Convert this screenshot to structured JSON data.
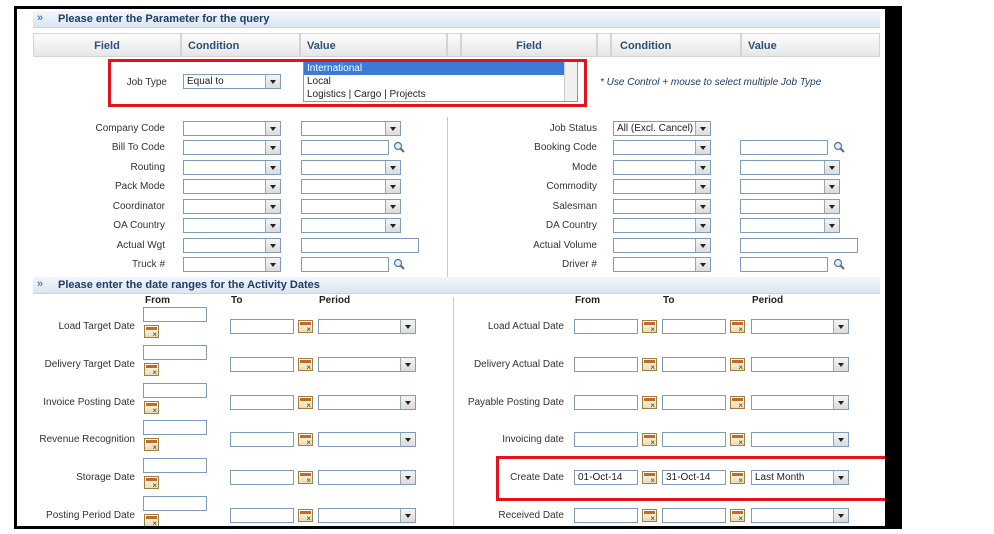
{
  "param_section": {
    "title": "Please enter the Parameter for the query"
  },
  "date_section": {
    "title": "Please enter the date ranges for the Activity Dates"
  },
  "columns": {
    "field": "Field",
    "condition": "Condition",
    "value": "Value"
  },
  "job_type": {
    "label": "Job Type",
    "condition": "Equal to",
    "options": [
      "International",
      "Local",
      "Logistics | Cargo | Projects"
    ],
    "selected": "International",
    "note": "* Use Control + mouse to select multiple Job Type"
  },
  "left_fields": [
    {
      "label": "Company Code"
    },
    {
      "label": "Bill To Code"
    },
    {
      "label": "Routing"
    },
    {
      "label": "Pack Mode"
    },
    {
      "label": "Coordinator"
    },
    {
      "label": "OA Country"
    },
    {
      "label": "Actual Wgt"
    },
    {
      "label": "Truck #"
    }
  ],
  "right_fields": [
    {
      "label": "Job Status",
      "condition": "All (Excl. Cancel)"
    },
    {
      "label": "Booking Code"
    },
    {
      "label": "Mode"
    },
    {
      "label": "Commodity"
    },
    {
      "label": "Salesman"
    },
    {
      "label": "DA Country"
    },
    {
      "label": "Actual Volume"
    },
    {
      "label": "Driver #"
    }
  ],
  "date_headers": {
    "from": "From",
    "to": "To",
    "period": "Period"
  },
  "left_dates": [
    {
      "label": "Load Target Date"
    },
    {
      "label": "Delivery Target Date"
    },
    {
      "label": "Invoice Posting Date"
    },
    {
      "label": "Revenue Recognition"
    },
    {
      "label": "Storage Date"
    },
    {
      "label": "Posting Period Date"
    }
  ],
  "right_dates": [
    {
      "label": "Load Actual Date",
      "from": "",
      "to": "",
      "period": ""
    },
    {
      "label": "Delivery Actual Date",
      "from": "",
      "to": "",
      "period": ""
    },
    {
      "label": "Payable Posting Date",
      "from": "",
      "to": "",
      "period": ""
    },
    {
      "label": "Invoicing date",
      "from": "",
      "to": "",
      "period": ""
    },
    {
      "label": "Create Date",
      "from": "01-Oct-14",
      "to": "31-Oct-14",
      "period": "Last Month"
    },
    {
      "label": "Received Date",
      "from": "",
      "to": "",
      "period": ""
    }
  ],
  "colors": {
    "highlight_box": "#e0141c",
    "header_text": "#2c4f7a",
    "selection": "#3a7ad8"
  }
}
